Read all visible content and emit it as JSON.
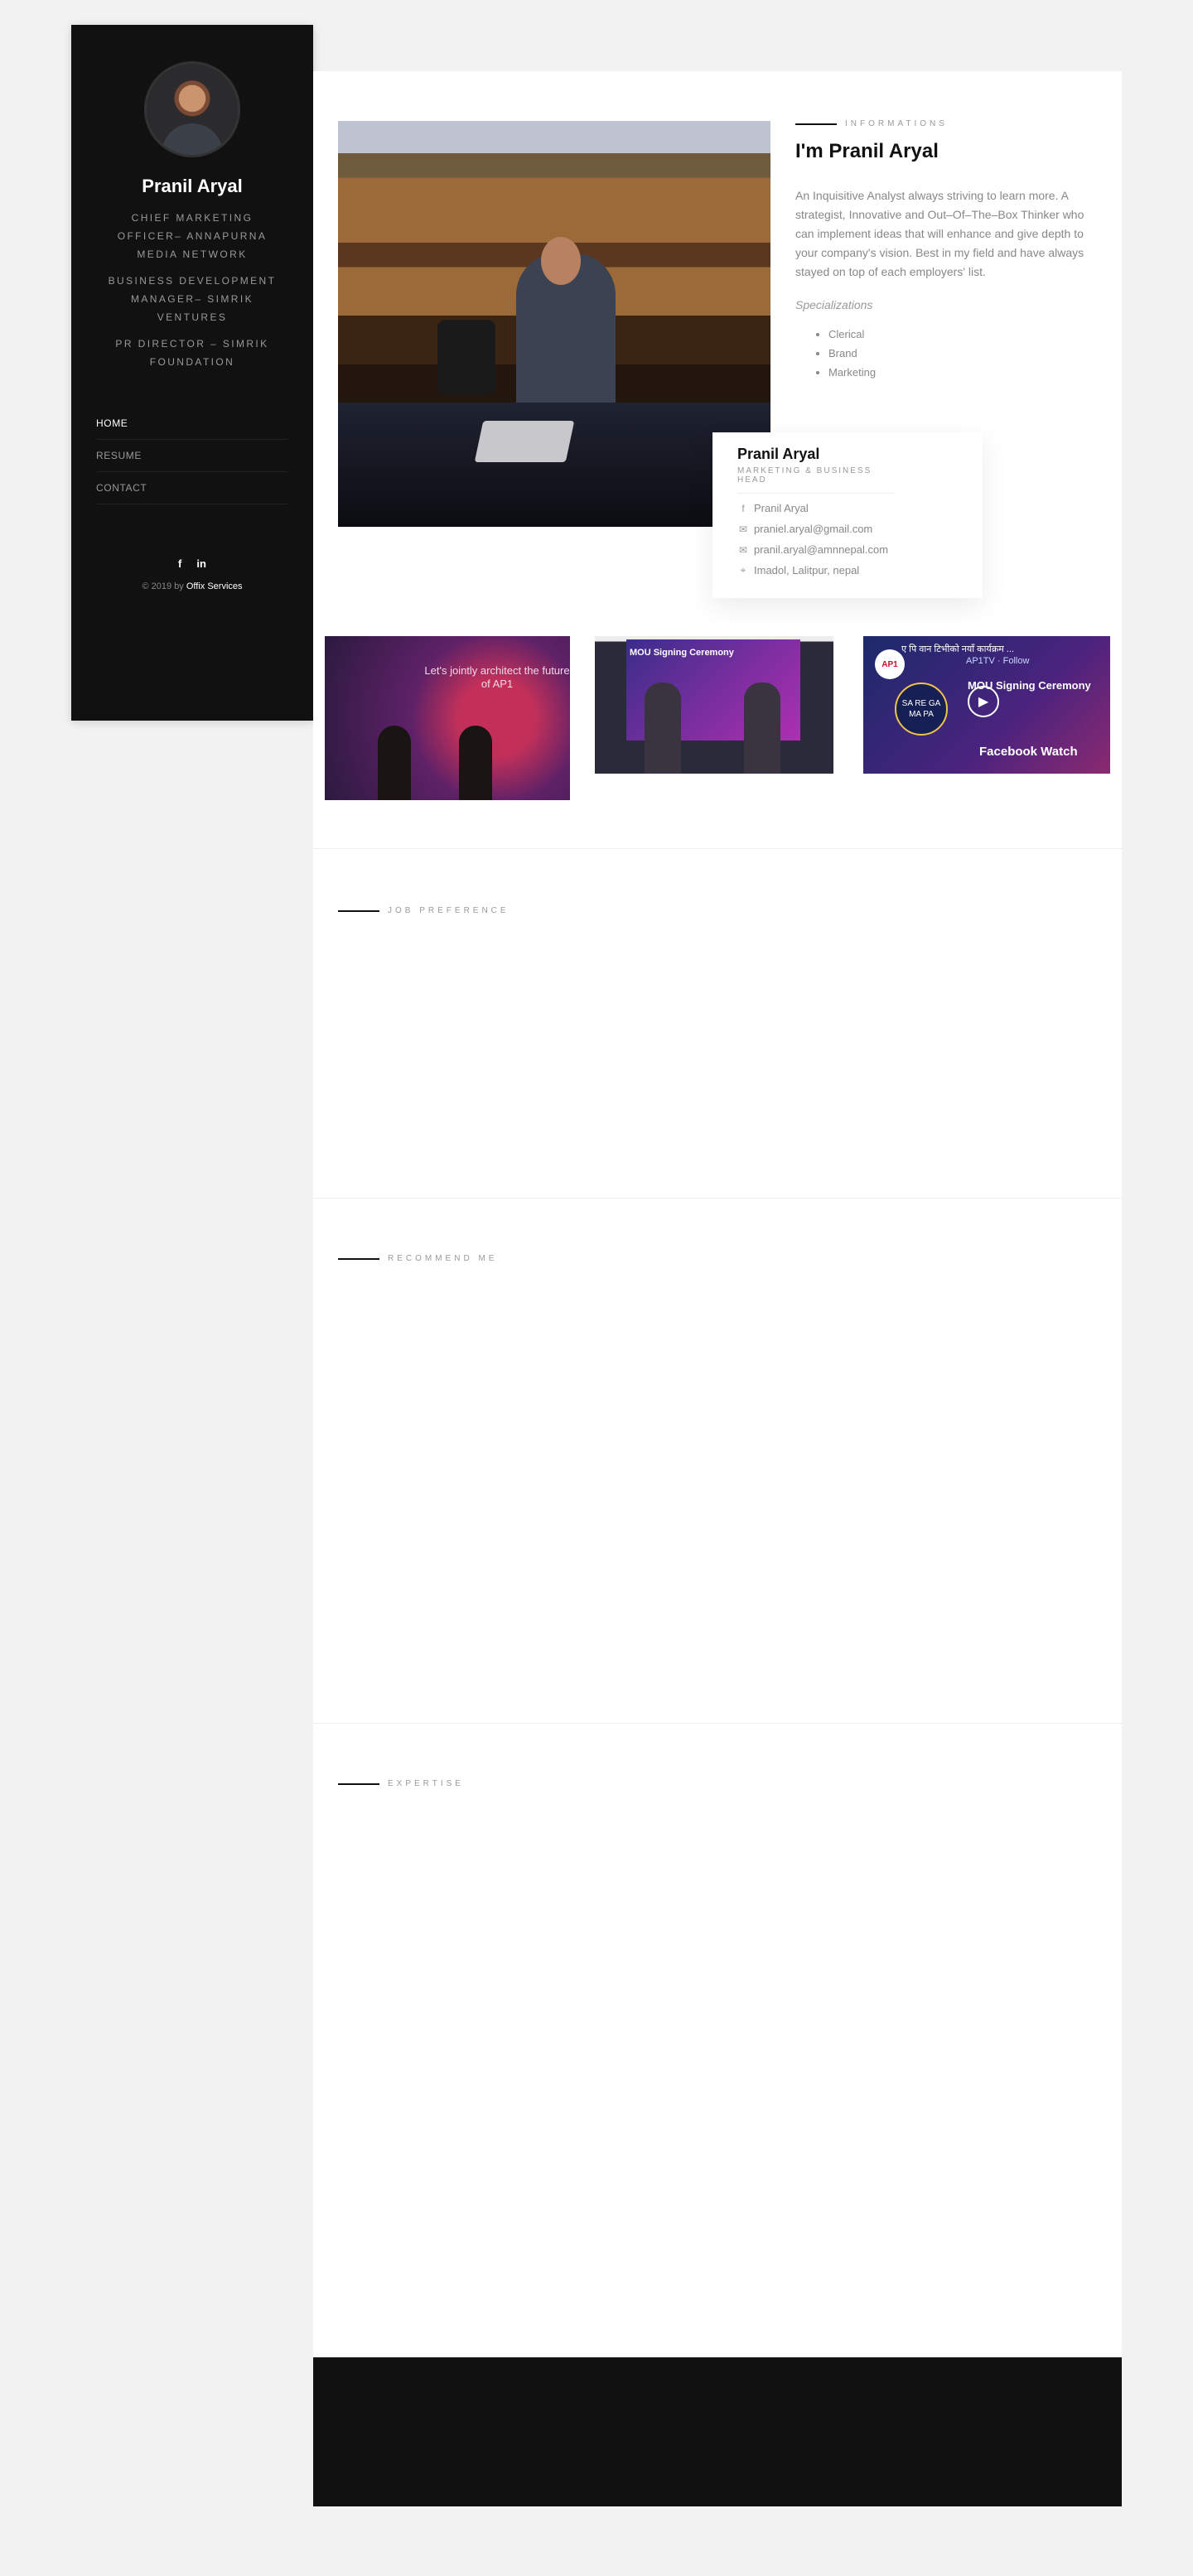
{
  "sidebar": {
    "name": "Pranil Aryal",
    "roles": [
      "CHIEF MARKETING OFFICER– ANNAPURNA MEDIA NETWORK",
      "BUSINESS DEVELOPMENT MANAGER– SIMRIK VENTURES",
      "PR DIRECTOR – SIMRIK FOUNDATION"
    ],
    "nav": [
      "HOME",
      "RESUME",
      "CONTACT"
    ],
    "social": [
      "facebook-icon",
      "linkedin-icon"
    ],
    "social_glyphs": [
      "f",
      "in"
    ],
    "copyright_prefix": "© 2019 by",
    "copyright_link": "Offix Services"
  },
  "info": {
    "label": "INFORMATIONS",
    "heading": "I'm Pranil Aryal",
    "bio": "An Inquisitive Analyst always striving to learn more. A strategist, Innovative and Out–Of–The–Box Thinker who can implement ideas that will enhance and give depth to your company's vision. Best in my field and have always stayed on top of each employers' list.",
    "spec_title": "Specializations",
    "specializations": [
      "Clerical",
      "Brand",
      "Marketing"
    ]
  },
  "card": {
    "name": "Pranil Aryal",
    "title": "MARKETING & BUSINESS HEAD",
    "facebook": "Pranil Aryal",
    "email1": "praniel.aryal@gmail.com",
    "email2": "pranil.aryal@amnnepal.com",
    "location": "Imadol, Lalitpur, nepal"
  },
  "thumbs": {
    "t1_caption": "Let's jointly architect the future of AP1",
    "t2_caption": "MOU Signing Ceremony",
    "t3_header": "ए पि वान टिभीको नयाँ कार्यक्रम ...",
    "t3_channel": "AP1TV · Follow",
    "t3_caption": "MOU Signing Ceremony",
    "t3_badge": "SA RE GA MA PA",
    "t3_watch": "Facebook Watch",
    "t3_logo": "AP1"
  },
  "sections": {
    "job": "JOB PREFERENCE",
    "recommend": "RECOMMEND ME",
    "expertise": "EXPERTISE"
  },
  "colors": {
    "sidebar_bg": "#111111",
    "page_bg": "#f2f2f2",
    "accent": "#111111"
  }
}
